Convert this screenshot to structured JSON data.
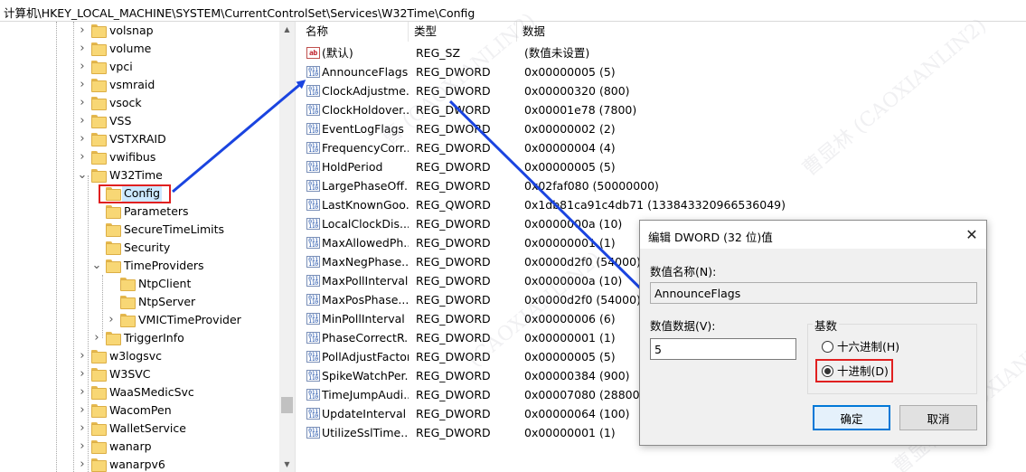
{
  "address": "计算机\\HKEY_LOCAL_MACHINE\\SYSTEM\\CurrentControlSet\\Services\\W32Time\\Config",
  "tree": {
    "items": [
      {
        "label": "volsnap",
        "depth": 0,
        "expander": ">"
      },
      {
        "label": "volume",
        "depth": 0,
        "expander": ">"
      },
      {
        "label": "vpci",
        "depth": 0,
        "expander": ">"
      },
      {
        "label": "vsmraid",
        "depth": 0,
        "expander": ">"
      },
      {
        "label": "vsock",
        "depth": 0,
        "expander": ">"
      },
      {
        "label": "VSS",
        "depth": 0,
        "expander": ">"
      },
      {
        "label": "VSTXRAID",
        "depth": 0,
        "expander": ">"
      },
      {
        "label": "vwifibus",
        "depth": 0,
        "expander": ">"
      },
      {
        "label": "W32Time",
        "depth": 0,
        "expander": "v"
      },
      {
        "label": "Config",
        "depth": 1,
        "expander": "",
        "selected": true
      },
      {
        "label": "Parameters",
        "depth": 1,
        "expander": ""
      },
      {
        "label": "SecureTimeLimits",
        "depth": 1,
        "expander": ""
      },
      {
        "label": "Security",
        "depth": 1,
        "expander": ""
      },
      {
        "label": "TimeProviders",
        "depth": 1,
        "expander": "v"
      },
      {
        "label": "NtpClient",
        "depth": 2,
        "expander": ""
      },
      {
        "label": "NtpServer",
        "depth": 2,
        "expander": ""
      },
      {
        "label": "VMICTimeProvider",
        "depth": 2,
        "expander": ">"
      },
      {
        "label": "TriggerInfo",
        "depth": 1,
        "expander": ">"
      },
      {
        "label": "w3logsvc",
        "depth": 0,
        "expander": ">"
      },
      {
        "label": "W3SVC",
        "depth": 0,
        "expander": ">"
      },
      {
        "label": "WaaSMedicSvc",
        "depth": 0,
        "expander": ">"
      },
      {
        "label": "WacomPen",
        "depth": 0,
        "expander": ">"
      },
      {
        "label": "WalletService",
        "depth": 0,
        "expander": ">"
      },
      {
        "label": "wanarp",
        "depth": 0,
        "expander": ">"
      },
      {
        "label": "wanarpv6",
        "depth": 0,
        "expander": ">"
      }
    ]
  },
  "list": {
    "columns": [
      "名称",
      "类型",
      "数据"
    ],
    "rows": [
      {
        "name": "(默认)",
        "type": "REG_SZ",
        "data": "(数值未设置)",
        "icon": "string-value-icon",
        "glyph": "ab"
      },
      {
        "name": "AnnounceFlags",
        "type": "REG_DWORD",
        "data": "0x00000005 (5)",
        "icon": "binary-value-icon",
        "glyph": "011\n110"
      },
      {
        "name": "ClockAdjustme...",
        "type": "REG_DWORD",
        "data": "0x00000320 (800)",
        "icon": "binary-value-icon",
        "glyph": "011\n110"
      },
      {
        "name": "ClockHoldover...",
        "type": "REG_DWORD",
        "data": "0x00001e78 (7800)",
        "icon": "binary-value-icon",
        "glyph": "011\n110"
      },
      {
        "name": "EventLogFlags",
        "type": "REG_DWORD",
        "data": "0x00000002 (2)",
        "icon": "binary-value-icon",
        "glyph": "011\n110"
      },
      {
        "name": "FrequencyCorr...",
        "type": "REG_DWORD",
        "data": "0x00000004 (4)",
        "icon": "binary-value-icon",
        "glyph": "011\n110"
      },
      {
        "name": "HoldPeriod",
        "type": "REG_DWORD",
        "data": "0x00000005 (5)",
        "icon": "binary-value-icon",
        "glyph": "011\n110"
      },
      {
        "name": "LargePhaseOff...",
        "type": "REG_DWORD",
        "data": "0x02faf080 (50000000)",
        "icon": "binary-value-icon",
        "glyph": "011\n110"
      },
      {
        "name": "LastKnownGoo...",
        "type": "REG_QWORD",
        "data": "0x1db81ca91c4db71 (133843320966536049)",
        "icon": "binary-value-icon",
        "glyph": "011\n110"
      },
      {
        "name": "LocalClockDis...",
        "type": "REG_DWORD",
        "data": "0x0000000a (10)",
        "icon": "binary-value-icon",
        "glyph": "011\n110"
      },
      {
        "name": "MaxAllowedPh...",
        "type": "REG_DWORD",
        "data": "0x00000001 (1)",
        "icon": "binary-value-icon",
        "glyph": "011\n110"
      },
      {
        "name": "MaxNegPhase...",
        "type": "REG_DWORD",
        "data": "0x0000d2f0 (54000)",
        "icon": "binary-value-icon",
        "glyph": "011\n110"
      },
      {
        "name": "MaxPollInterval",
        "type": "REG_DWORD",
        "data": "0x0000000a (10)",
        "icon": "binary-value-icon",
        "glyph": "011\n110"
      },
      {
        "name": "MaxPosPhase...",
        "type": "REG_DWORD",
        "data": "0x0000d2f0 (54000)",
        "icon": "binary-value-icon",
        "glyph": "011\n110"
      },
      {
        "name": "MinPollInterval",
        "type": "REG_DWORD",
        "data": "0x00000006 (6)",
        "icon": "binary-value-icon",
        "glyph": "011\n110"
      },
      {
        "name": "PhaseCorrectR...",
        "type": "REG_DWORD",
        "data": "0x00000001 (1)",
        "icon": "binary-value-icon",
        "glyph": "011\n110"
      },
      {
        "name": "PollAdjustFactor",
        "type": "REG_DWORD",
        "data": "0x00000005 (5)",
        "icon": "binary-value-icon",
        "glyph": "011\n110"
      },
      {
        "name": "SpikeWatchPer...",
        "type": "REG_DWORD",
        "data": "0x00000384 (900)",
        "icon": "binary-value-icon",
        "glyph": "011\n110"
      },
      {
        "name": "TimeJumpAudi...",
        "type": "REG_DWORD",
        "data": "0x00007080 (28800)",
        "icon": "binary-value-icon",
        "glyph": "011\n110"
      },
      {
        "name": "UpdateInterval",
        "type": "REG_DWORD",
        "data": "0x00000064 (100)",
        "icon": "binary-value-icon",
        "glyph": "011\n110"
      },
      {
        "name": "UtilizeSslTime...",
        "type": "REG_DWORD",
        "data": "0x00000001 (1)",
        "icon": "binary-value-icon",
        "glyph": "011\n110"
      }
    ]
  },
  "dialog": {
    "title": "编辑 DWORD (32 位)值",
    "close_glyph": "✕",
    "name_label": "数值名称(N):",
    "name_value": "AnnounceFlags",
    "data_label": "数值数据(V):",
    "data_value": "5",
    "base_label": "基数",
    "radio_hex": "十六进制(H)",
    "radio_dec": "十进制(D)",
    "selected_base": "dec",
    "ok": "确定",
    "cancel": "取消"
  },
  "annotations": {
    "arrow_color": "#1a44e0",
    "highlight_color": "#e02020"
  },
  "colors": {
    "selection": "#cce8ff",
    "folder": "#f8d775",
    "accent": "#0078d7"
  }
}
